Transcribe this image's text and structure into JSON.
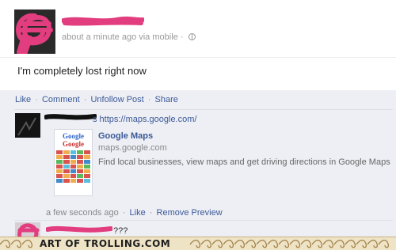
{
  "post": {
    "meta_text": "about a minute ago via mobile · ",
    "status": "I'm completely lost right now"
  },
  "actions": {
    "like": "Like",
    "comment": "Comment",
    "unfollow": "Unfollow Post",
    "share": "Share",
    "separator": "·"
  },
  "comment1": {
    "url_text": "s https://maps.google.com/",
    "preview": {
      "logo_a": "Google",
      "logo_b": "Google",
      "title": "Google Maps",
      "domain": "maps.google.com",
      "description": "Find local businesses, view maps and get driving directions in Google Maps"
    },
    "time": "a few seconds ago",
    "like": "Like",
    "remove_preview": "Remove Preview"
  },
  "comment2": {
    "text": "???"
  },
  "footer": {
    "text": "ART OF TROLLING.COM"
  },
  "colors": {
    "link": "#3b5998",
    "scribble": "#e23d7e",
    "feedback_bg": "#edeff4",
    "footer_bg": "#efe3c6"
  }
}
